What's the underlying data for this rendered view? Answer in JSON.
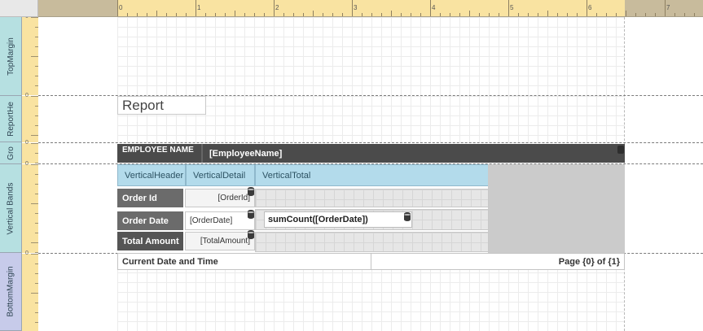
{
  "ruler": {
    "numbers": [
      "0",
      "1",
      "2",
      "3",
      "4",
      "5",
      "6",
      "7"
    ]
  },
  "vruler": {
    "numbers": [
      "0",
      "0",
      "0",
      "0",
      "0"
    ]
  },
  "bands": {
    "top_margin": "TopMargin",
    "report_header": "ReportHe",
    "group_header": "Gro",
    "vertical_bands": "Vertical Bands",
    "bottom_margin": "BottomMargin"
  },
  "report_header": {
    "title": "Report"
  },
  "group_header": {
    "label": "EMPLOYEE NAME",
    "field": "[EmployeeName]"
  },
  "vertical_bands": {
    "headers": [
      "VerticalHeader",
      "VerticalDetail",
      "VerticalTotal"
    ],
    "rows": [
      {
        "label": "Order Id",
        "detail": "[OrderId]"
      },
      {
        "label": "Order Date",
        "detail": "[OrderDate]"
      },
      {
        "label": "Total Amount",
        "detail": "[TotalAmount]"
      }
    ],
    "summary": "sumCount([OrderDate])"
  },
  "footer": {
    "left": "Current Date and Time",
    "right": "Page {0} of {1}"
  },
  "colors": {
    "ruler_page": "#f9e3a1",
    "ruler_margin": "#c8bb9c",
    "band_teal": "#b6e0e1",
    "band_lavender": "#c7cbea",
    "header_dark": "#4b4b4b",
    "vertical_header": "#b3dbeb"
  }
}
